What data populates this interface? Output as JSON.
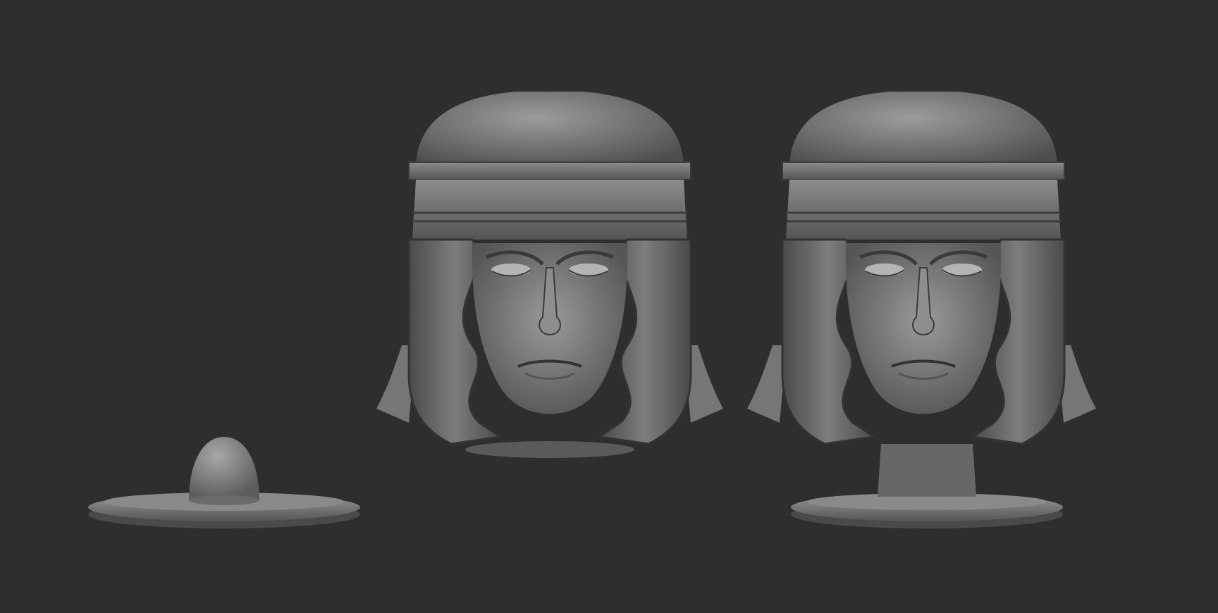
{
  "viewport": {
    "background": "#2e2e2e",
    "material_light": "#9a9a9a",
    "material_mid": "#6e6e6e",
    "material_dark": "#3f3f3f"
  },
  "models": [
    {
      "name": "base-with-peg",
      "icon": "pedestal-shape"
    },
    {
      "name": "helmeted-head-bust",
      "icon": "bust-shape"
    },
    {
      "name": "helmeted-head-bust-on-base",
      "icon": "bust-shape"
    }
  ]
}
